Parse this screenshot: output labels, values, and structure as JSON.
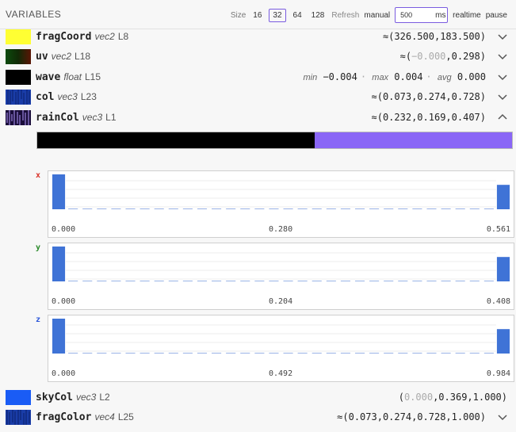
{
  "header": {
    "title": "VARIABLES",
    "size_label": "Size",
    "sizes": [
      "16",
      "32",
      "64",
      "128"
    ],
    "active_size": "32",
    "refresh_label": "Refresh",
    "manual_label": "manual",
    "interval_value": "500",
    "interval_unit": "ms",
    "realtime_label": "realtime",
    "pause_label": "pause"
  },
  "variables": [
    {
      "name": "fragCoord",
      "type": "vec2",
      "line": "L8",
      "value": "≈(326.500,183.500)"
    },
    {
      "name": "uv",
      "type": "vec2",
      "line": "L18",
      "prefix": "≈(",
      "dim_part": "−0.000",
      "rest": ",0.298)"
    },
    {
      "name": "wave",
      "type": "float",
      "line": "L15",
      "min_label": "min",
      "min": "−0.004",
      "max_label": "max",
      "max": "0.004",
      "avg_label": "avg",
      "avg": "0.000"
    },
    {
      "name": "col",
      "type": "vec3",
      "line": "L23",
      "value": "≈(0.073,0.274,0.728)"
    },
    {
      "name": "rainCol",
      "type": "vec3",
      "line": "L1",
      "value": "≈(0.232,0.169,0.407)"
    },
    {
      "name": "skyCol",
      "type": "vec3",
      "line": "L2",
      "prefix": "(",
      "dim_part": "0.000",
      "rest": ",0.369,1.000)"
    },
    {
      "name": "fragColor",
      "type": "vec4",
      "line": "L25",
      "value": "≈(0.073,0.274,0.728,1.000)"
    }
  ],
  "color_bar": {
    "black_fraction": 0.585,
    "colors": {
      "black": "#000000",
      "purple": "#8a66f6"
    }
  },
  "histograms": [
    {
      "axis": "x",
      "color": "#d9342b",
      "ticks": [
        "0.000",
        "0.280",
        "0.561"
      ],
      "bins": [
        1,
        0,
        0,
        0,
        0,
        0,
        0,
        0,
        0,
        0,
        0,
        0,
        0,
        0,
        0,
        0,
        0,
        0,
        0,
        0,
        0,
        0,
        0,
        0,
        0,
        0,
        0,
        0,
        0,
        0,
        0,
        0.7
      ]
    },
    {
      "axis": "y",
      "color": "#2a8a2a",
      "ticks": [
        "0.000",
        "0.204",
        "0.408"
      ],
      "bins": [
        1,
        0,
        0,
        0,
        0,
        0,
        0,
        0,
        0,
        0,
        0,
        0,
        0,
        0,
        0,
        0,
        0,
        0,
        0,
        0,
        0,
        0,
        0,
        0,
        0,
        0,
        0,
        0,
        0,
        0,
        0,
        0.7
      ]
    },
    {
      "axis": "z",
      "color": "#2a55d9",
      "ticks": [
        "0.000",
        "0.492",
        "0.984"
      ],
      "bins": [
        1,
        0,
        0,
        0,
        0,
        0,
        0,
        0,
        0,
        0,
        0,
        0,
        0,
        0,
        0,
        0,
        0,
        0,
        0,
        0,
        0,
        0,
        0,
        0,
        0,
        0,
        0,
        0,
        0,
        0,
        0,
        0.7
      ]
    }
  ]
}
